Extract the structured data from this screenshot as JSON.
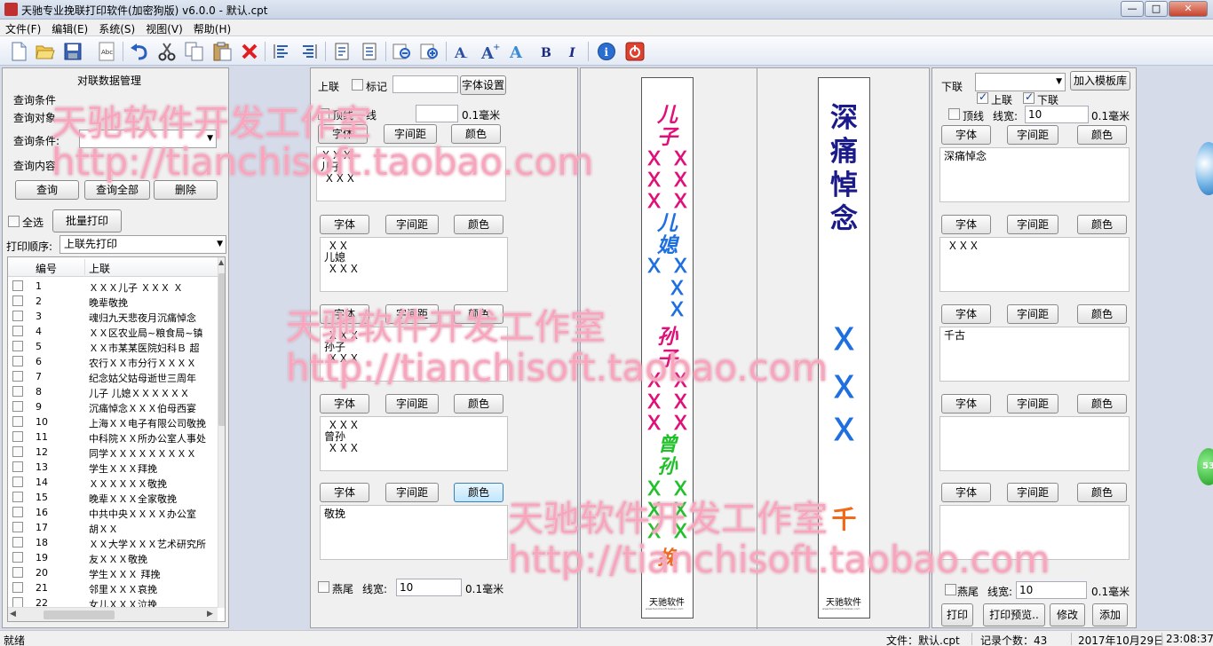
{
  "window": {
    "title": "天驰专业挽联打印软件(加密狗版) v6.0.0  - 默认.cpt",
    "min": "—",
    "max": "□",
    "close": "✕"
  },
  "menu": [
    "文件(F)",
    "编辑(E)",
    "系统(S)",
    "视图(V)",
    "帮助(H)"
  ],
  "toolbar_icons": [
    "new-file-icon",
    "open-folder-icon",
    "save-icon",
    "spell-icon",
    "undo-icon",
    "cut-icon",
    "copy-icon",
    "paste-icon",
    "delete-icon",
    "align-left-icon",
    "align-right-icon",
    "page-prev-icon",
    "page-next-icon",
    "zoom-out-icon",
    "zoom-in-icon",
    "font-smaller-icon",
    "font-larger-icon",
    "font-color-icon",
    "bold-icon",
    "italic-icon",
    "info-icon",
    "exit-icon"
  ],
  "left": {
    "title": "对联数据管理",
    "query_field_label": "查询条件",
    "query_target_label": "查询对象",
    "query_cond_label": "查询条件:",
    "query_content_label": "查询内容",
    "btn_query": "查询",
    "btn_query_all": "查询全部",
    "btn_delete": "删除",
    "select_all": "全选",
    "btn_batch_print": "批量打印",
    "print_order_label": "打印顺序:",
    "print_order_value": "上联先打印",
    "col_no": "编号",
    "col_text": "上联",
    "rows": [
      {
        "no": "1",
        "text": "  ＸＸＸ儿子  ＸＸＸ Ｘ"
      },
      {
        "no": "2",
        "text": "  晚辈敬挽"
      },
      {
        "no": "3",
        "text": "魂归九天悲夜月沉痛悼念"
      },
      {
        "no": "4",
        "text": "ＸＸ区农业局~粮食局~镇"
      },
      {
        "no": "5",
        "text": "ＸＸ市某某医院妇科Ｂ 超"
      },
      {
        "no": "6",
        "text": "农行ＸＸ市分行ＸＸＸＸ"
      },
      {
        "no": "7",
        "text": " 纪念姑父姑母逝世三周年"
      },
      {
        "no": "8",
        "text": "  儿子 儿媳ＸＸＸＸＸＸ"
      },
      {
        "no": "9",
        "text": "沉痛悼念ＸＸＸ伯母西宴"
      },
      {
        "no": "10",
        "text": "上海ＸＸ电子有限公司敬挽"
      },
      {
        "no": "11",
        "text": "中科院ＸＸ所办公室人事处"
      },
      {
        "no": "12",
        "text": "同学ＸＸＸＸＸＸＸＸＸ"
      },
      {
        "no": "13",
        "text": "学生ＸＸＸ拜挽"
      },
      {
        "no": "14",
        "text": "ＸＸＸＸＸＸ敬挽"
      },
      {
        "no": "15",
        "text": "晚辈ＸＸＸ全家敬挽"
      },
      {
        "no": "16",
        "text": " 中共中央ＸＸＸＸ办公室"
      },
      {
        "no": "17",
        "text": "  胡ＸＸ"
      },
      {
        "no": "18",
        "text": "ＸＸ大学ＸＸＸ艺术研究所"
      },
      {
        "no": "19",
        "text": " 友ＸＸＸ敬挽"
      },
      {
        "no": "20",
        "text": "学生ＸＸＸ 拜挽"
      },
      {
        "no": "21",
        "text": "邻里ＸＸＸ哀挽"
      },
      {
        "no": "22",
        "text": "女儿ＸＸＸ泣挽"
      }
    ]
  },
  "upper": {
    "label": "上联",
    "mark_label": "标记",
    "mark_value": "",
    "font_setting": "字体设置",
    "topline_label": "顶线",
    "topline_hint": "线",
    "unit": "0.1毫米",
    "btn_font": "字体",
    "btn_spacing": "字间距",
    "btn_color": "颜色",
    "sections": [
      {
        "text": "ＸＸＸ\n儿子\n ＸＸＸ"
      },
      {
        "text": " ＸＸ\n儿媳\n ＸＸＸ"
      },
      {
        "text": " ＸＸＸ\n孙子\n ＸＸＸ"
      },
      {
        "text": " ＸＸＸ\n曾孙\n ＸＸＸ"
      },
      {
        "text": "敬挽"
      }
    ],
    "swallowtail_label": "燕尾",
    "linewidth_label": "线宽:",
    "linewidth_value": "10"
  },
  "preview_left": {
    "footer": "天驰软件",
    "footer_small": "www.tianchisoft.taobao.com"
  },
  "preview_right": {
    "chars": [
      "深",
      "痛",
      "悼",
      "念",
      "Ｘ",
      "Ｘ",
      "Ｘ"
    ],
    "footer": "天驰软件",
    "footer_small": "www.tianchisoft.taobao.com"
  },
  "lower": {
    "label": "下联",
    "combo_value": "",
    "btn_add_template": "加入模板库",
    "chk_upper": "上联",
    "chk_lower": "下联",
    "topline_label": "顶线",
    "linewidth_label": "线宽:",
    "linewidth_value": "10",
    "unit": "0.1毫米",
    "btn_font": "字体",
    "btn_spacing": "字间距",
    "btn_color": "颜色",
    "sections": [
      {
        "text": "深痛悼念"
      },
      {
        "text": " ＸＸＸ"
      },
      {
        "text": "千古"
      },
      {
        "text": ""
      },
      {
        "text": ""
      }
    ],
    "swallowtail_label": "燕尾",
    "linewidth2_value": "10",
    "btn_print": "打印",
    "btn_print_preview": "打印预览..",
    "btn_modify": "修改",
    "btn_add": "添加"
  },
  "side_badge": "53",
  "watermark": {
    "line1": "天驰软件开发工作室",
    "line2": "http://tianchisoft.taobao.com"
  },
  "status": {
    "ready": "就绪",
    "file": "文件：默认.cpt",
    "record_count": "记录个数：43",
    "date": "2017年10月29日",
    "time": "23:08:37"
  },
  "colors": {
    "magenta": "#e0107a",
    "blue": "#1e6fe0",
    "navy": "#1a1a8a",
    "green": "#22c02a",
    "orange": "#f06a1a"
  }
}
